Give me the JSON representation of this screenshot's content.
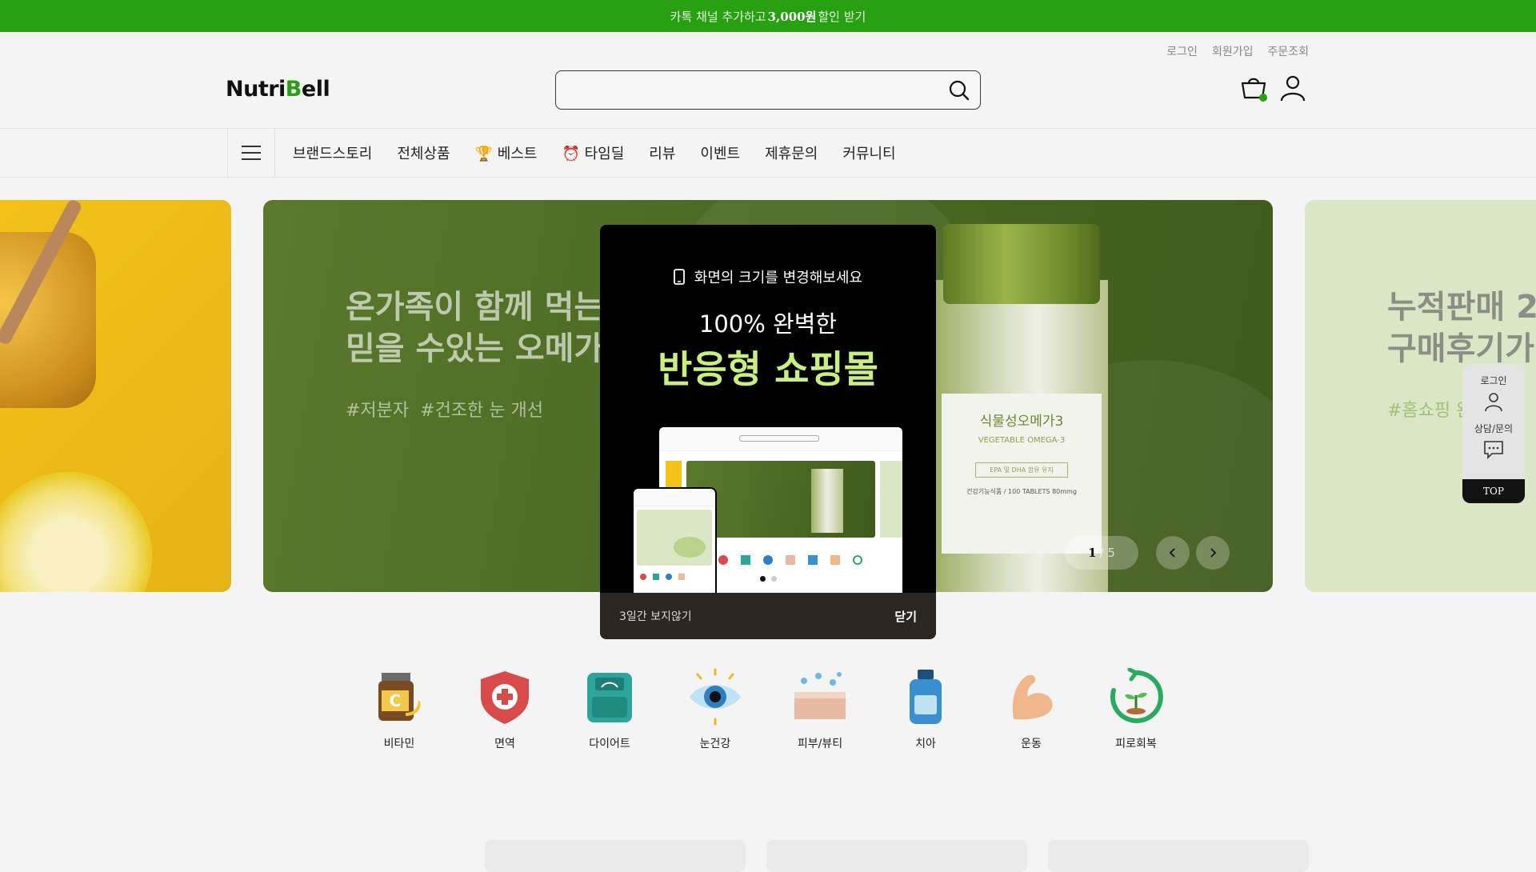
{
  "topbar": {
    "text_before": "카톡 채널 추가하고",
    "amount": "3,000원",
    "text_after": "할인 받기"
  },
  "util_links": [
    "로그인",
    "회원가입",
    "주문조회"
  ],
  "logo": {
    "text_start": "Nutri",
    "text_accent": "B",
    "text_end": "ell"
  },
  "search": {
    "placeholder": ""
  },
  "nav": {
    "items": [
      "브랜드스토리",
      "전체상품",
      "🏆 베스트",
      "⏰ 타임딜",
      "리뷰",
      "이벤트",
      "제휴문의",
      "커뮤니티"
    ]
  },
  "slide_main": {
    "title_line1": "온가족이 함께 먹는",
    "title_line2": "믿을 수있는 오메가",
    "tags": "#저분자  #건조한 눈 개선",
    "label_name": "식물성오메가3",
    "label_en": "VEGETABLE OMEGA-3",
    "label_badge": "EPA 및 DHA 함유 유지",
    "label_info": "건강기능식품 / 100 TABLETS 80mmg",
    "pager_current": "1",
    "pager_total": "/ 5"
  },
  "slide_right": {
    "title_line1": "누적판매 2",
    "title_line2": "구매후기가",
    "tag": "#홈쇼핑 완"
  },
  "quick_menu": {
    "login": "로그인",
    "consult": "상담/문의",
    "top": "TOP"
  },
  "categories": [
    {
      "label": "비타민",
      "icon": "vitamin-icon",
      "color": "#7a4a22"
    },
    {
      "label": "면역",
      "icon": "immune-shield-icon",
      "color": "#d94b4b"
    },
    {
      "label": "다이어트",
      "icon": "scale-icon",
      "color": "#2ea59a"
    },
    {
      "label": "눈건강",
      "icon": "eye-icon",
      "color": "#2f7fc0"
    },
    {
      "label": "피부/뷰티",
      "icon": "skin-icon",
      "color": "#e8b9a3"
    },
    {
      "label": "치아",
      "icon": "mouthwash-icon",
      "color": "#3a8fd0"
    },
    {
      "label": "운동",
      "icon": "muscle-icon",
      "color": "#f0b78d"
    },
    {
      "label": "피로회복",
      "icon": "recovery-icon",
      "color": "#2aaa5e"
    }
  ],
  "modal": {
    "hint": "화면의 크기를 변경해보세요",
    "line1": "100% 완벽한",
    "line2": "반응형 쇼핑몰",
    "no_show": "3일간 보지않기",
    "close": "닫기"
  },
  "colors": {
    "brand_green": "#27a012",
    "accent_lime": "#c8f080"
  }
}
